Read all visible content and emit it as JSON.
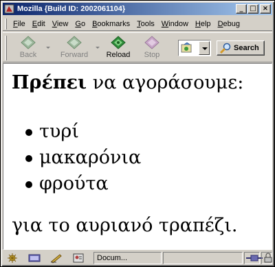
{
  "window": {
    "title": "Mozilla {Build ID: 2002061104}"
  },
  "title_buttons": {
    "minimize": "_",
    "maximize": "□",
    "close": "×"
  },
  "menu": [
    {
      "label": "File",
      "accel": "F",
      "rest": "ile"
    },
    {
      "label": "Edit",
      "accel": "E",
      "rest": "dit"
    },
    {
      "label": "View",
      "accel": "V",
      "rest": "iew"
    },
    {
      "label": "Go",
      "accel": "G",
      "rest": "o"
    },
    {
      "label": "Bookmarks",
      "accel": "B",
      "rest": "ookmarks"
    },
    {
      "label": "Tools",
      "accel": "T",
      "rest": "ools"
    },
    {
      "label": "Window",
      "accel": "W",
      "rest": "indow"
    },
    {
      "label": "Help",
      "accel": "H",
      "rest": "elp"
    },
    {
      "label": "Debug",
      "accel": "D",
      "rest": "ebug"
    }
  ],
  "toolbar": {
    "back_label": "Back",
    "forward_label": "Forward",
    "reload_label": "Reload",
    "stop_label": "Stop",
    "search_label": "Search"
  },
  "content": {
    "heading_bold": "Πρέπει",
    "heading_rest": " να αγοράσουμε:",
    "items": [
      "τυρί",
      "μακαρόνια",
      "φρούτα"
    ],
    "closing": "για το αυριανό τραπέζι."
  },
  "status": {
    "text": "Docum..."
  },
  "colors": {
    "titlebar_start": "#0a246a",
    "titlebar_end": "#a6caf0",
    "chrome": "#d4d0c8"
  }
}
